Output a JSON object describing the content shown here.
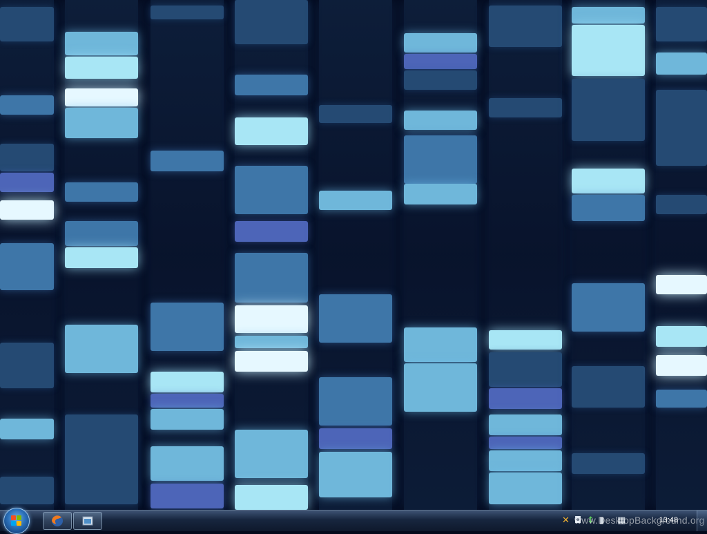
{
  "desktop": {
    "wallpaper": "DNA gel electrophoresis bands",
    "accent_colors": [
      "#e6f8ff",
      "#a8e6f5",
      "#6fb7da",
      "#3e76a8",
      "#254a73",
      "#4d65b8"
    ]
  },
  "taskbar": {
    "start_icon": "windows-orb-icon",
    "pinned": [
      {
        "name": "firefox",
        "icon": "firefox-icon"
      },
      {
        "name": "picture-viewer",
        "icon": "image-window-icon"
      }
    ],
    "tray_icons": [
      "tools-icon",
      "shield-icon",
      "network-icon",
      "battery-icon",
      "calendar-icon"
    ],
    "watermark": "www.DesktopBackground.org",
    "clock": "13:48"
  }
}
